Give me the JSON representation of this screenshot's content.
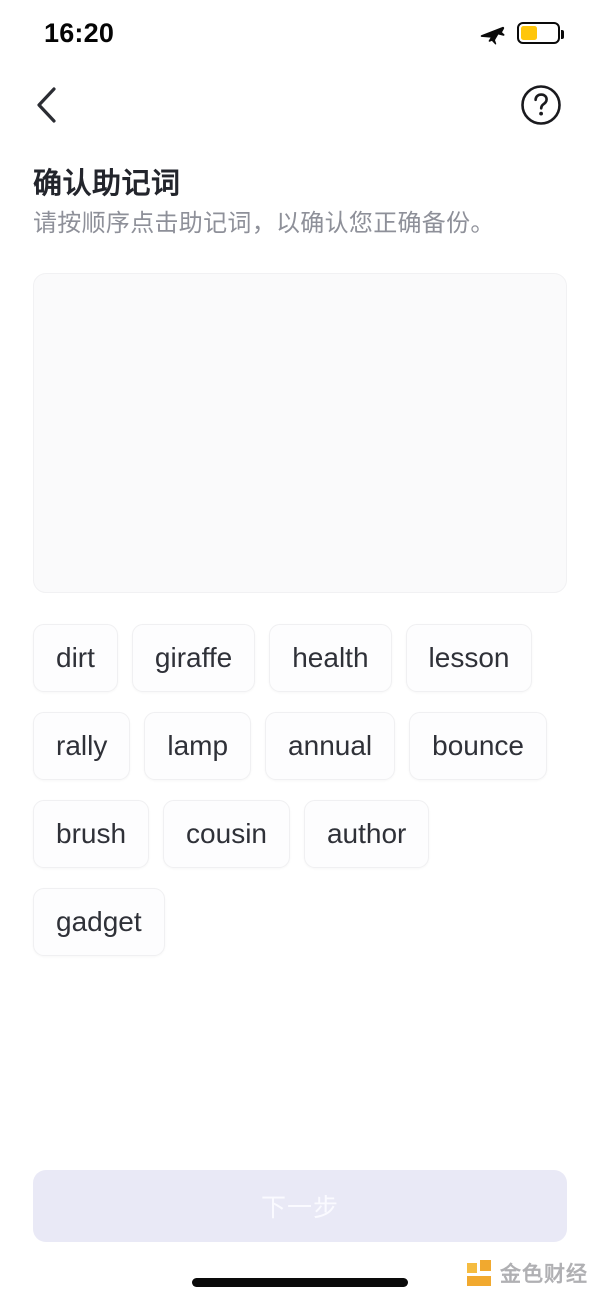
{
  "status_bar": {
    "time": "16:20",
    "airplane_icon": "airplane-mode-icon",
    "battery_icon": "battery-low-power-icon",
    "battery_level_percent": 45,
    "battery_color": "#ffc60b"
  },
  "nav_bar": {
    "back_icon": "chevron-left-icon",
    "help_icon": "question-circle-icon"
  },
  "header": {
    "title": "确认助记词",
    "subtitle": "请按顺序点击助记词，以确认您正确备份。",
    "title_color": "#23252c",
    "subtitle_color": "#8e9099"
  },
  "dropzone": {
    "selected_words": [],
    "background_color": "#fafafb",
    "border_color": "#f1f1f3"
  },
  "word_bank": {
    "words": [
      "dirt",
      "giraffe",
      "health",
      "lesson",
      "rally",
      "lamp",
      "annual",
      "bounce",
      "brush",
      "cousin",
      "author",
      "gadget"
    ],
    "chip_background": "#fdfdfe",
    "chip_text_color": "#2f3138"
  },
  "footer": {
    "next_button_label": "下一步",
    "next_button_enabled": false,
    "next_button_background": "#e9e9f6",
    "next_button_text_color": "#fafaff"
  },
  "watermark": {
    "text": "金色财经",
    "logo_color": "#f0a21e",
    "text_color": "#aaaaad"
  }
}
